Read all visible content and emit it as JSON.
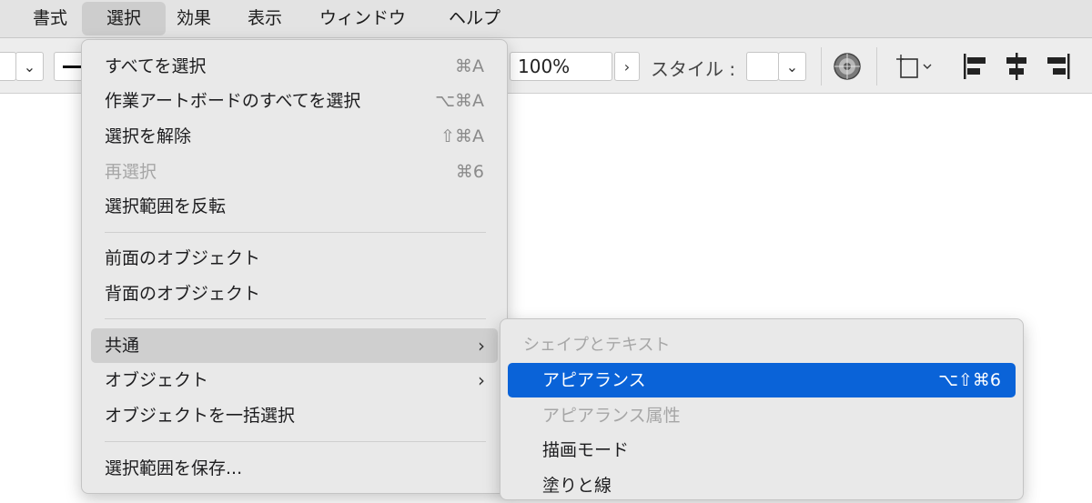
{
  "menubar": {
    "items": [
      "書式",
      "選択",
      "効果",
      "表示",
      "ウィンドウ",
      "ヘルプ"
    ],
    "active_index": 1
  },
  "toolbar": {
    "opacity_value": "100%",
    "style_label": "スタイル :",
    "icons": [
      "chevron-down-icon",
      "stroke-line-icon",
      "chevron-right-icon",
      "recolor-icon",
      "artboard-icon",
      "align-left-icon",
      "align-center-icon",
      "align-right-icon"
    ]
  },
  "select_menu": {
    "items": [
      {
        "label": "すべてを選択",
        "shortcut": "⌘A",
        "disabled": false
      },
      {
        "label": "作業アートボードのすべてを選択",
        "shortcut": "⌥⌘A",
        "disabled": false
      },
      {
        "label": "選択を解除",
        "shortcut": "⇧⌘A",
        "disabled": false
      },
      {
        "label": "再選択",
        "shortcut": "⌘6",
        "disabled": true
      },
      {
        "label": "選択範囲を反転",
        "shortcut": "",
        "disabled": false
      },
      {
        "label": "前面のオブジェクト",
        "shortcut": "",
        "disabled": false
      },
      {
        "label": "背面のオブジェクト",
        "shortcut": "",
        "disabled": false
      },
      {
        "label": "共通",
        "shortcut": "",
        "disabled": false,
        "submenu": true,
        "highlighted": true
      },
      {
        "label": "オブジェクト",
        "shortcut": "",
        "disabled": false,
        "submenu": true
      },
      {
        "label": "オブジェクトを一括選択",
        "shortcut": "",
        "disabled": false
      },
      {
        "label": "選択範囲を保存...",
        "shortcut": "",
        "disabled": false
      }
    ]
  },
  "common_submenu": {
    "header": "シェイプとテキスト",
    "items": [
      {
        "label": "アピアランス",
        "shortcut": "⌥⇧⌘6",
        "selected": true,
        "disabled": false
      },
      {
        "label": "アピアランス属性",
        "shortcut": "",
        "disabled": true
      },
      {
        "label": "描画モード",
        "shortcut": "",
        "disabled": false
      },
      {
        "label": "塗りと線",
        "shortcut": "",
        "disabled": false
      }
    ]
  },
  "colors": {
    "selection_blue": "#0a63d8",
    "menu_bg": "#e9e9e9",
    "disabled_text": "#a6a6a6"
  }
}
